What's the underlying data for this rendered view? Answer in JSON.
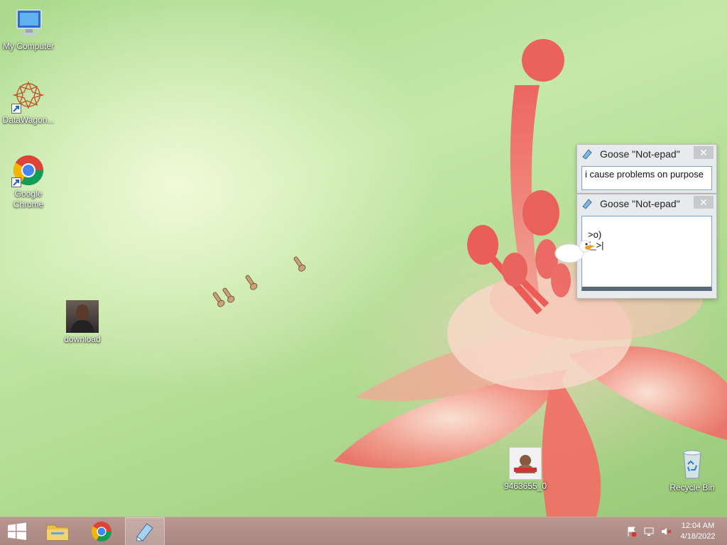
{
  "desktop_icons": {
    "my_computer": "My Computer",
    "datawagon": "DataWagon...",
    "chrome": "Google Chrome",
    "download": "download",
    "image_file": "9463655_0",
    "recycle_bin": "Recycle Bin"
  },
  "goose_windows": [
    {
      "title": "Goose \"Not-epad\"",
      "close": "✕",
      "text": "i cause problems on purpose"
    },
    {
      "title": "Goose \"Not-epad\"",
      "close": "✕",
      "line1": ">o)",
      "line2": "(_>|"
    }
  ],
  "taskbar": {
    "clock_time": "12:04 AM",
    "clock_date": "4/18/2022"
  },
  "colors": {
    "taskbar": "#a88782",
    "flower": "#f07f78",
    "wallpaper": "#b3dc94"
  }
}
